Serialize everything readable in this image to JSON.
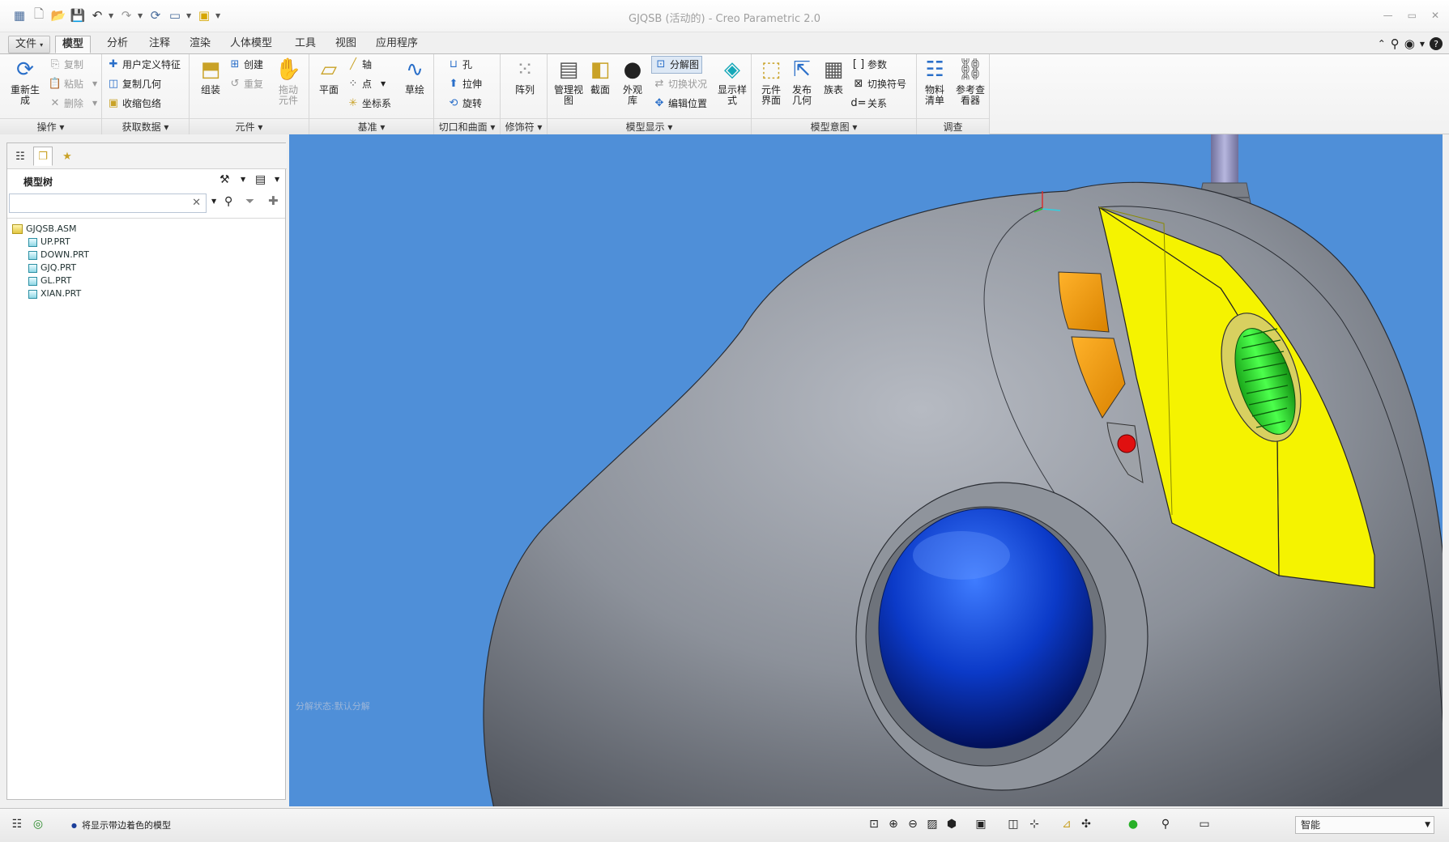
{
  "window": {
    "title": "GJQSB (活动的) - Creo Parametric 2.0",
    "controls": [
      "—",
      "▭",
      "✕"
    ]
  },
  "menu": {
    "file": "文件",
    "tabs": [
      "模型",
      "分析",
      "注释",
      "渲染",
      "人体模型",
      "工具",
      "视图",
      "应用程序"
    ]
  },
  "ribbon": {
    "operations": {
      "label": "操作",
      "regenerate": "重新生成",
      "copy": "复制",
      "paste": "粘贴",
      "delete": "删除"
    },
    "get_data": {
      "label": "获取数据",
      "udf": "用户定义特征",
      "copy_geom": "复制几何",
      "shrinkwrap": "收缩包络"
    },
    "component": {
      "label": "元件",
      "assemble": "组装",
      "create": "创建",
      "repeat": "重复",
      "drag": "拖动元件"
    },
    "datum": {
      "label": "基准",
      "plane": "平面",
      "axis": "轴",
      "point": "点",
      "csys": "坐标系",
      "sketch": "草绘"
    },
    "cut_surface": {
      "label": "切口和曲面",
      "hole": "孔",
      "extrude": "拉伸",
      "revolve": "旋转"
    },
    "modifiers": {
      "label": "修饰符",
      "pattern": "阵列"
    },
    "model_display": {
      "label": "模型显示",
      "manage_views": "管理视图",
      "section": "截面",
      "appearance": "外观库",
      "explode": "分解图",
      "toggle_status": "切换状况",
      "edit_position": "编辑位置",
      "display_style": "显示样式"
    },
    "model_intent": {
      "label": "模型意图",
      "comp_interface": "元件界面",
      "publish_geom": "发布几何",
      "family_table": "族表",
      "params": "参数",
      "switch_symbol": "切换符号",
      "relations": "关系"
    },
    "investigate": {
      "label": "调查",
      "bom": "物料清单",
      "ref_viewer": "参考查看器"
    }
  },
  "model_tree": {
    "title": "模型树",
    "search_placeholder": "",
    "root": "GJQSB.ASM",
    "items": [
      "UP.PRT",
      "DOWN.PRT",
      "GJQ.PRT",
      "GL.PRT",
      "XIAN.PRT"
    ]
  },
  "viewport": {
    "status_text": "分解状态:默认分解",
    "background": "#4f8fd8"
  },
  "statusbar": {
    "message": "将显示带边着色的模型",
    "filter": "智能"
  },
  "colors": {
    "body": "#8a8f98",
    "buttons_yellow": "#f5f300",
    "side_buttons": "#f0a000",
    "ball": "#0b3ac8",
    "wheel": "#2ecc2e",
    "red_button": "#e01010"
  }
}
